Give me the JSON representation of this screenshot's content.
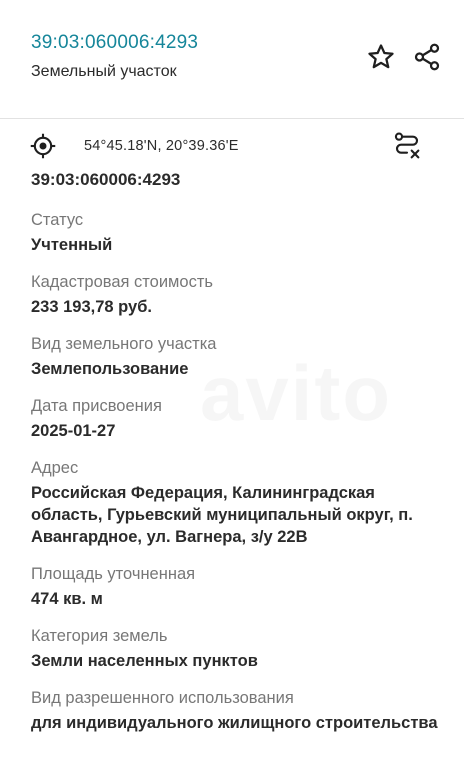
{
  "header": {
    "cadastral_number": "39:03:060006:4293",
    "object_type": "Земельный участок",
    "star_icon": "star-outline-icon",
    "share_icon": "share-icon"
  },
  "coords_bar": {
    "target_icon": "crosshair-target-icon",
    "coordinates": "54°45.18'N, 20°39.36'E",
    "route_icon": "route-clear-icon"
  },
  "details": {
    "cadastral_number_value": "39:03:060006:4293",
    "fields": [
      {
        "label": "Статус",
        "value": "Учтенный"
      },
      {
        "label": "Кадастровая стоимость",
        "value": "233 193,78 руб."
      },
      {
        "label": "Вид земельного участка",
        "value": "Землепользование"
      },
      {
        "label": "Дата присвоения",
        "value": "2025-01-27"
      },
      {
        "label": "Адрес",
        "value": "Российская Федерация, Калининградская область, Гурьевский муниципальный округ, п. Авангардное, ул. Вагнера, з/у 22В"
      },
      {
        "label": "Площадь уточненная",
        "value": "474 кв. м"
      },
      {
        "label": "Категория земель",
        "value": "Земли населенных пунктов"
      },
      {
        "label": "Вид разрешенного использования",
        "value": "для индивидуального жилищного строительства"
      }
    ]
  },
  "colors": {
    "accent": "#16869a",
    "label": "#777777",
    "value": "#2b2b2b"
  }
}
